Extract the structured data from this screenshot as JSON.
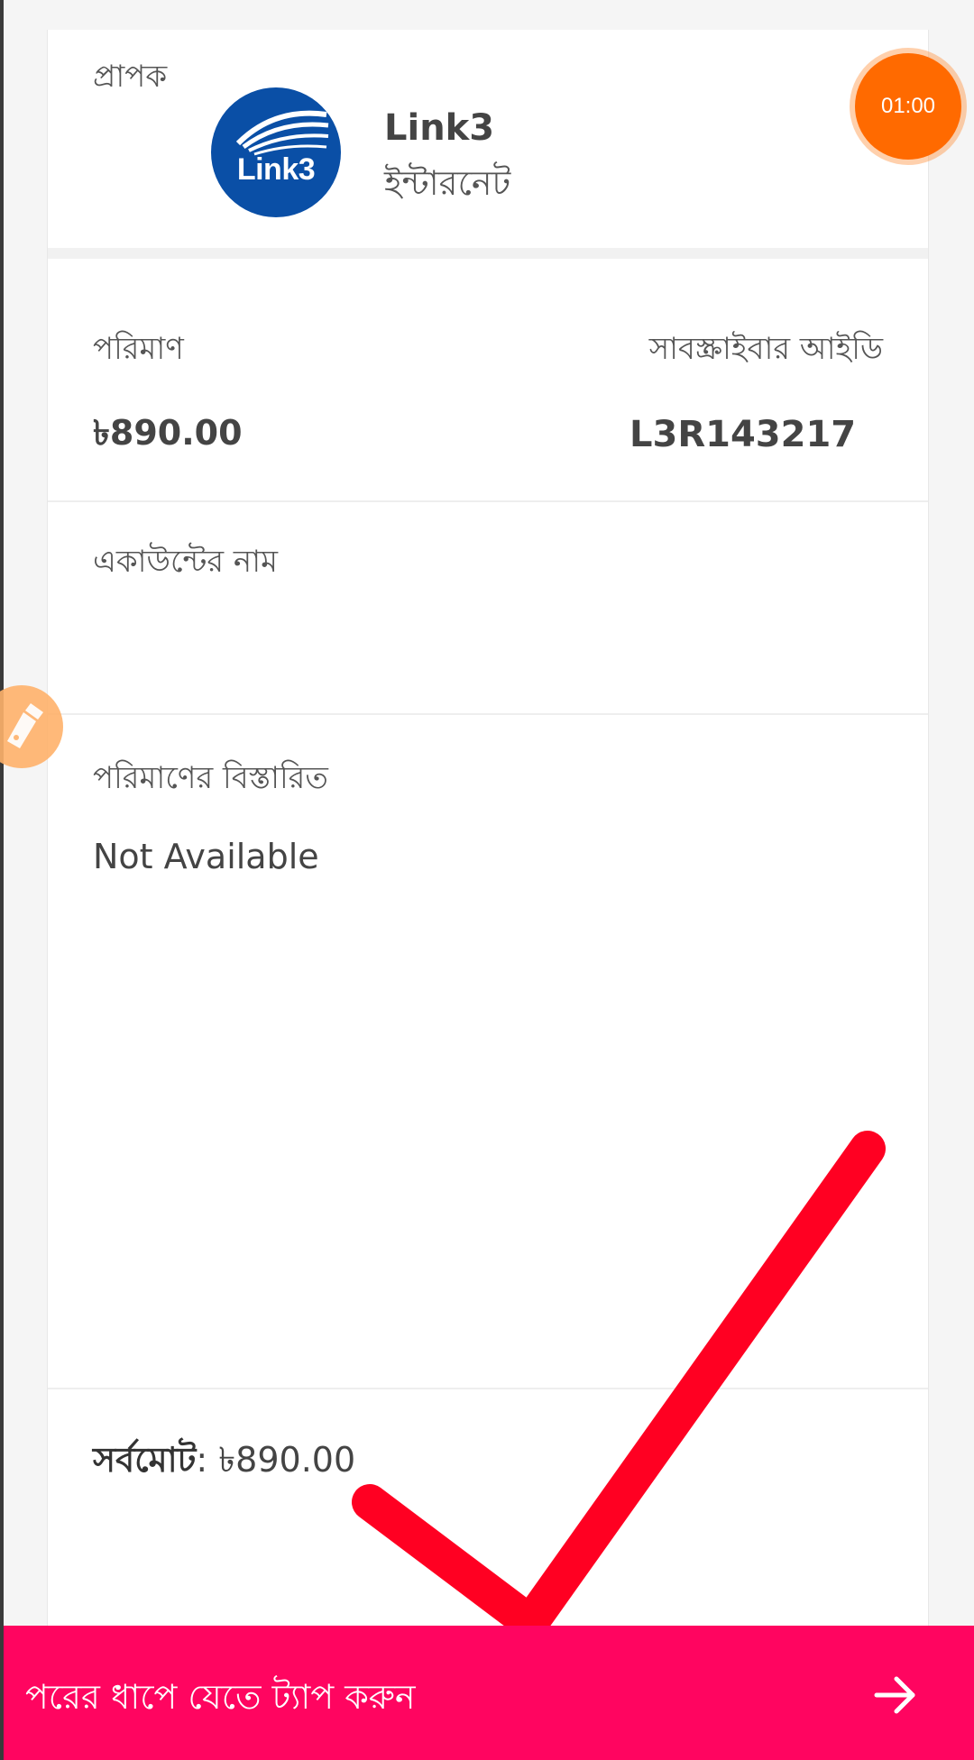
{
  "timer": {
    "text": "01:00"
  },
  "recipient": {
    "label": "প্রাপক",
    "logo_text": "Link3",
    "name": "Link3",
    "category": "ইন্টারনেট"
  },
  "amount": {
    "label": "পরিমাণ",
    "value": "৳890.00"
  },
  "subscriber": {
    "label": "সাবস্ক্রাইবার আইডি",
    "value": "L3R143217"
  },
  "account": {
    "label": "একাউন্টের নাম",
    "value": ""
  },
  "details": {
    "label": "পরিমাণের বিস্তারিত",
    "value": "Not Available"
  },
  "total": {
    "label": "সর্বমোট",
    "value": "৳890.00"
  },
  "next": {
    "label": "পরের ধাপে যেতে ট্যাপ করুন"
  },
  "colors": {
    "accent": "#ff0560",
    "timer": "#ff6a00",
    "checkmark": "#ff0022",
    "logo": "#0a4fa6"
  },
  "icons": [
    "link3-logo",
    "edit-pen-icon",
    "checkmark-overlay",
    "arrow-right-icon"
  ]
}
